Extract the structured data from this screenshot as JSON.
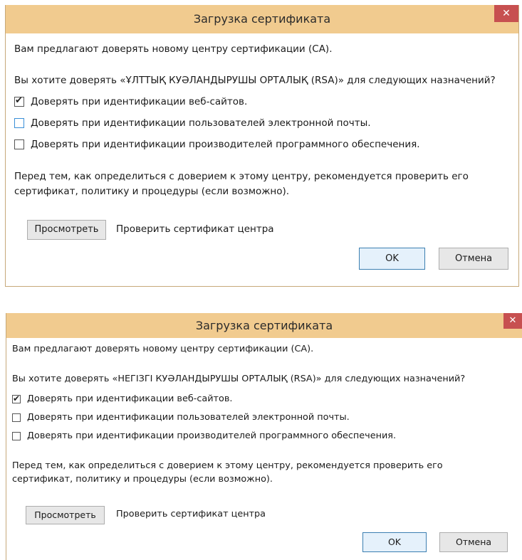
{
  "dialogs": [
    {
      "title": "Загрузка сертификата",
      "close_glyph": "✕",
      "intro": "Вам предлагают доверять новому центру сертификации (CA).",
      "question": "Вы хотите доверять «ҰЛТТЫҚ КУӘЛАНДЫРУШЫ ОРТАЛЫҚ (RSA)» для следующих назначений?",
      "options": [
        {
          "label": "Доверять при идентификации веб-сайтов.",
          "checked": true
        },
        {
          "label": "Доверять при идентификации пользователей электронной почты.",
          "checked": false
        },
        {
          "label": "Доверять при идентификации производителей программного обеспечения.",
          "checked": false
        }
      ],
      "recommend_line1": "Перед тем, как определиться с доверием к этому центру, рекомендуется проверить его",
      "recommend_line2": "сертификат, политику и процедуры (если возможно).",
      "view_button": "Просмотреть",
      "view_caption": "Проверить сертификат центра",
      "ok_button": "OK",
      "cancel_button": "Отмена"
    },
    {
      "title": "Загрузка сертификата",
      "close_glyph": "✕",
      "intro": "Вам предлагают доверять новому центру сертификации (CA).",
      "question": "Вы хотите доверять «НЕГІЗГІ КУӘЛАНДЫРУШЫ ОРТАЛЫҚ (RSA)» для следующих назначений?",
      "options": [
        {
          "label": "Доверять при идентификации веб-сайтов.",
          "checked": true
        },
        {
          "label": "Доверять при идентификации пользователей электронной почты.",
          "checked": false
        },
        {
          "label": "Доверять при идентификации производителей программного обеспечения.",
          "checked": false
        }
      ],
      "recommend_line1": "Перед тем, как определиться с доверием к этому центру, рекомендуется проверить его",
      "recommend_line2": "сертификат, политику и процедуры (если возможно).",
      "view_button": "Просмотреть",
      "view_caption": "Проверить сертификат центра",
      "ok_button": "OK",
      "cancel_button": "Отмена"
    }
  ],
  "colors": {
    "titlebar": "#f1cb8f",
    "close_button": "#c75050",
    "default_button_border": "#3c7fb1",
    "focus_checkbox": "#3a8fd7"
  }
}
